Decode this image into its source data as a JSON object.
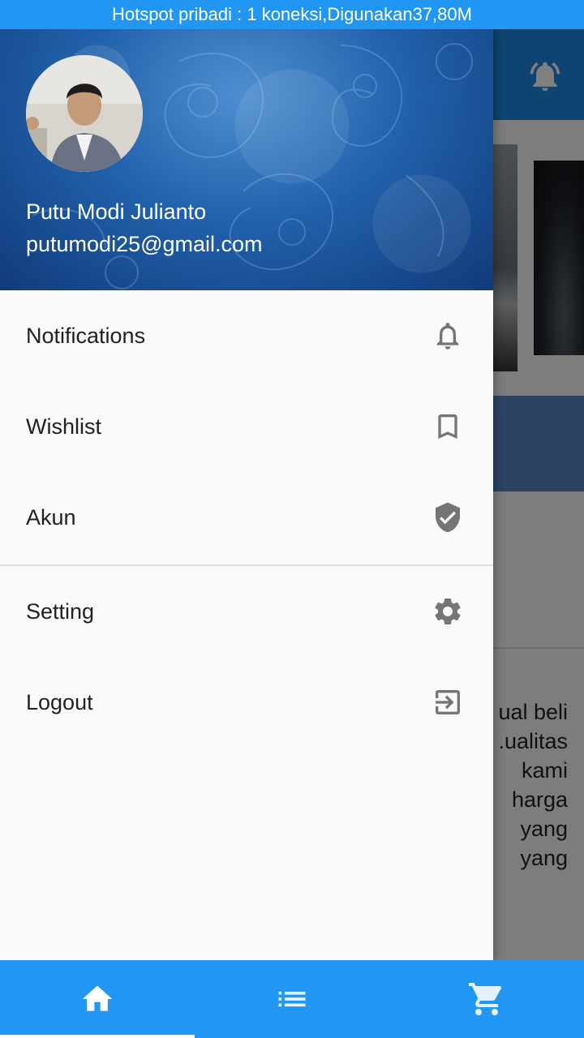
{
  "status_bar": {
    "text": "Hotspot pribadi : 1 koneksi,Digunakan37,80M"
  },
  "drawer": {
    "user": {
      "name": "Putu Modi Julianto",
      "email": "putumodi25@gmail.com"
    },
    "menu": [
      {
        "label": "Notifications",
        "icon": "bell-icon"
      },
      {
        "label": "Wishlist",
        "icon": "bookmark-icon"
      },
      {
        "label": "Akun",
        "icon": "verified-shield-icon"
      },
      {
        "label": "Setting",
        "icon": "gear-icon"
      },
      {
        "label": "Logout",
        "icon": "logout-icon"
      }
    ]
  },
  "background_page": {
    "text_lines": [
      "ual beli",
      "ualitas.",
      "kami",
      "harga",
      "yang",
      "yang"
    ]
  },
  "bottom_nav": {
    "items": [
      {
        "icon": "home-icon",
        "active": true
      },
      {
        "icon": "list-icon",
        "active": false
      },
      {
        "icon": "cart-icon",
        "active": false
      }
    ]
  },
  "colors": {
    "primary": "#2196f3",
    "icon_gray": "#757575",
    "text": "#212121"
  }
}
